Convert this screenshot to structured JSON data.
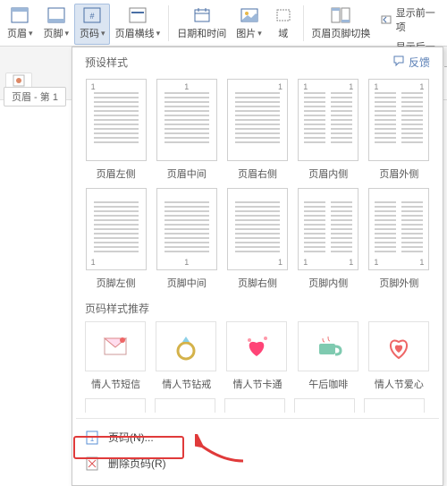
{
  "ribbon": {
    "header": "页眉",
    "footer": "页脚",
    "page_number": "页码",
    "header_line": "页眉横线",
    "date_time": "日期和时间",
    "picture": "图片",
    "field": "域",
    "hf_switch": "页眉页脚切换",
    "show_prev": "显示前一项",
    "show_next": "显示后一项"
  },
  "doc": {
    "header_tag": "页眉 - 第 1"
  },
  "dropdown": {
    "preset_title": "预设样式",
    "feedback": "反馈",
    "presets_header": [
      "页眉左侧",
      "页眉中间",
      "页眉右侧",
      "页眉内侧",
      "页眉外侧"
    ],
    "presets_footer": [
      "页脚左侧",
      "页脚中间",
      "页脚右侧",
      "页脚内侧",
      "页脚外侧"
    ],
    "style_title": "页码样式推荐",
    "styles": [
      "情人节短信",
      "情人节钻戒",
      "情人节卡通",
      "午后咖啡",
      "情人节爱心"
    ],
    "pn_item": "页码(N)...",
    "del_item": "删除页码(R)"
  },
  "one": "1"
}
